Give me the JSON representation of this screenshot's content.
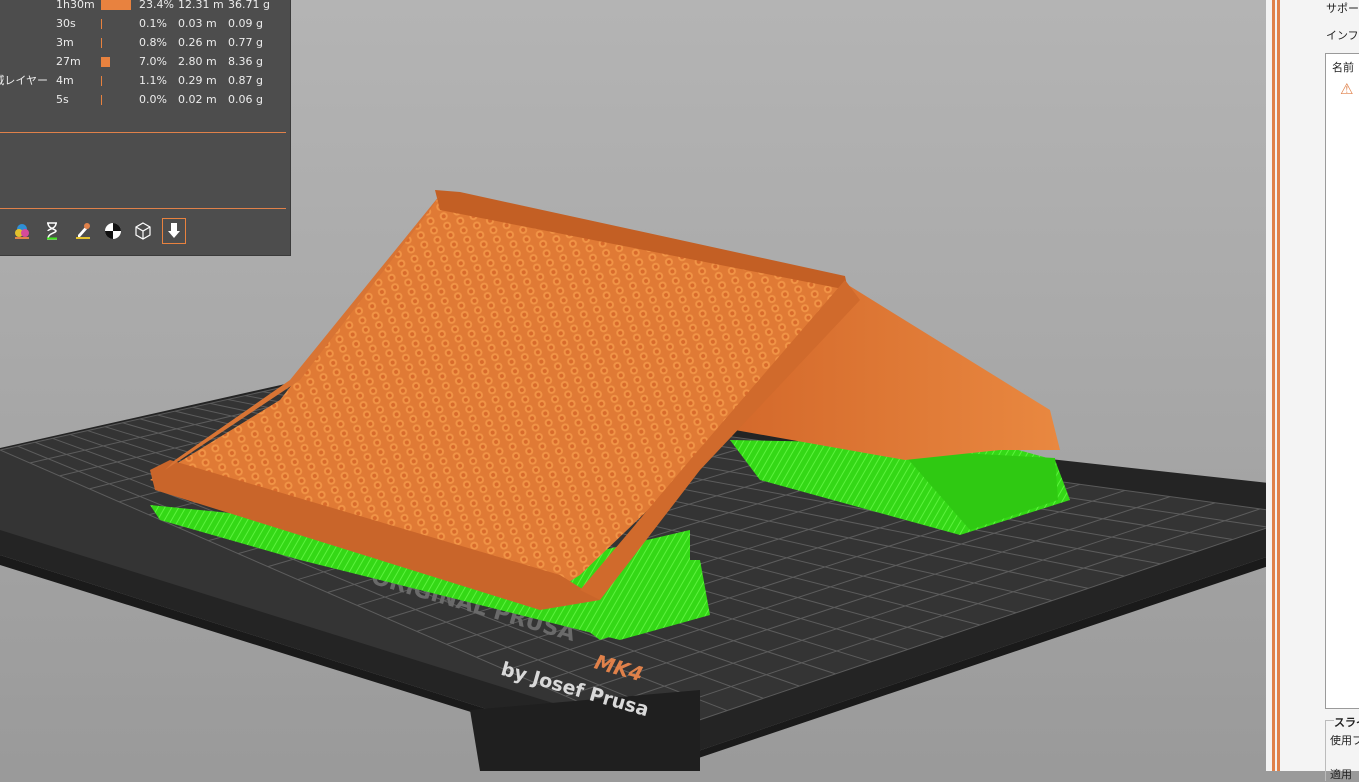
{
  "legend": {
    "rows": [
      {
        "feature": "",
        "time": "1h30m",
        "bar": 0.234,
        "percent": "23.4%",
        "length": "12.31 m",
        "weight": "36.71 g"
      },
      {
        "feature": "",
        "time": "30s",
        "bar": 0.001,
        "percent": "0.1%",
        "length": "0.03 m",
        "weight": "0.09 g"
      },
      {
        "feature": "",
        "time": "3m",
        "bar": 0.008,
        "percent": "0.8%",
        "length": "0.26 m",
        "weight": "0.77 g"
      },
      {
        "feature": "",
        "time": "27m",
        "bar": 0.07,
        "percent": "7.0%",
        "length": "2.80 m",
        "weight": "8.36 g"
      },
      {
        "feature": "域レイヤー",
        "time": "4m",
        "bar": 0.011,
        "percent": "1.1%",
        "length": "0.29 m",
        "weight": "0.87 g"
      },
      {
        "feature": "",
        "time": "5s",
        "bar": 0.0,
        "percent": "0.0%",
        "length": "0.02 m",
        "weight": "0.06 g"
      }
    ],
    "toolbar_icons": [
      "color-print-icon",
      "hourglass-icon",
      "tool-marker-icon",
      "center-of-gravity-icon",
      "shells-icon",
      "export-icon"
    ]
  },
  "bed": {
    "logo_line1": "ORIGINAL PRUSA",
    "logo_model": "MK4",
    "logo_line2": "by Josef Prusa"
  },
  "sidebar": {
    "support_label": "サポート",
    "infill_label": "インフィ",
    "list_header": "名前",
    "slice_group_label": "スライ",
    "slice_group_item": "使用フ",
    "slice_group_item2": "適用"
  },
  "colors": {
    "roof": "#e07a35",
    "support": "#3ee61c",
    "bed": "#2b2b2b",
    "accent": "#e0814a"
  }
}
